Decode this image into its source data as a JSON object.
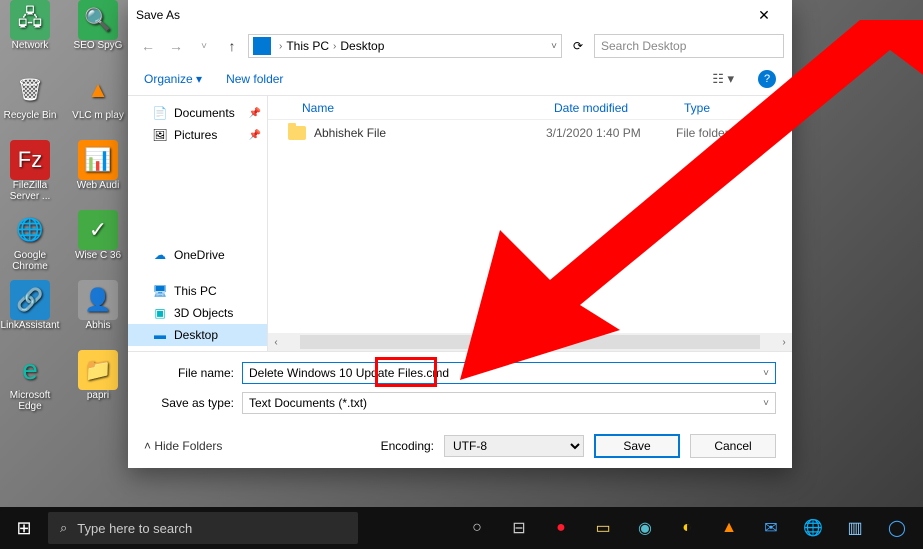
{
  "desktop": {
    "icons": [
      {
        "label": "Network",
        "color": "#4a6"
      },
      {
        "label": "SEO SpyG",
        "color": "#3a5"
      },
      {
        "label": "Recycle Bin",
        "color": "#5bd"
      },
      {
        "label": "VLC m play",
        "color": "#f80"
      },
      {
        "label": "FileZilla Server ...",
        "color": "#c22"
      },
      {
        "label": "Web Audi",
        "color": "#48c"
      },
      {
        "label": "Google Chrome",
        "color": "#fc4"
      },
      {
        "label": "Wise C 36",
        "color": "#4a4"
      },
      {
        "label": "LinkAssistant",
        "color": "#28c"
      },
      {
        "label": "Abhis",
        "color": "#999"
      },
      {
        "label": "Microsoft Edge",
        "color": "#0cbba8"
      },
      {
        "label": "papri",
        "color": "#fc4"
      }
    ]
  },
  "dialog": {
    "title": "Save As",
    "breadcrumb": {
      "root": "This PC",
      "leaf": "Desktop"
    },
    "search_placeholder": "Search Desktop",
    "toolbar": {
      "organize": "Organize",
      "newfolder": "New folder"
    },
    "sidebar": {
      "quick": [
        {
          "label": "Documents",
          "icon": "📄",
          "pinned": true
        },
        {
          "label": "Pictures",
          "icon": "🖼",
          "pinned": true
        }
      ],
      "drives": [
        {
          "label": "OneDrive",
          "icon": "☁",
          "color": "#0078d4"
        },
        {
          "label": "This PC",
          "icon": "🖥",
          "color": "#0078d4"
        },
        {
          "label": "3D Objects",
          "icon": "▣",
          "color": "#00b7c3"
        },
        {
          "label": "Desktop",
          "icon": "▬",
          "color": "#0078d4",
          "selected": true
        }
      ]
    },
    "columns": {
      "name": "Name",
      "date": "Date modified",
      "type": "Type"
    },
    "files": [
      {
        "name": "Abhishek File",
        "date": "3/1/2020 1:40 PM",
        "type": "File folder"
      }
    ],
    "form": {
      "filename_label": "File name:",
      "filename_value": "Delete Windows 10 Update Files.cmd",
      "savetype_label": "Save as type:",
      "savetype_value": "Text Documents (*.txt)"
    },
    "footer": {
      "hide": "Hide Folders",
      "encoding_label": "Encoding:",
      "encoding_value": "UTF-8",
      "save": "Save",
      "cancel": "Cancel"
    }
  },
  "taskbar": {
    "search_placeholder": "Type here to search"
  }
}
